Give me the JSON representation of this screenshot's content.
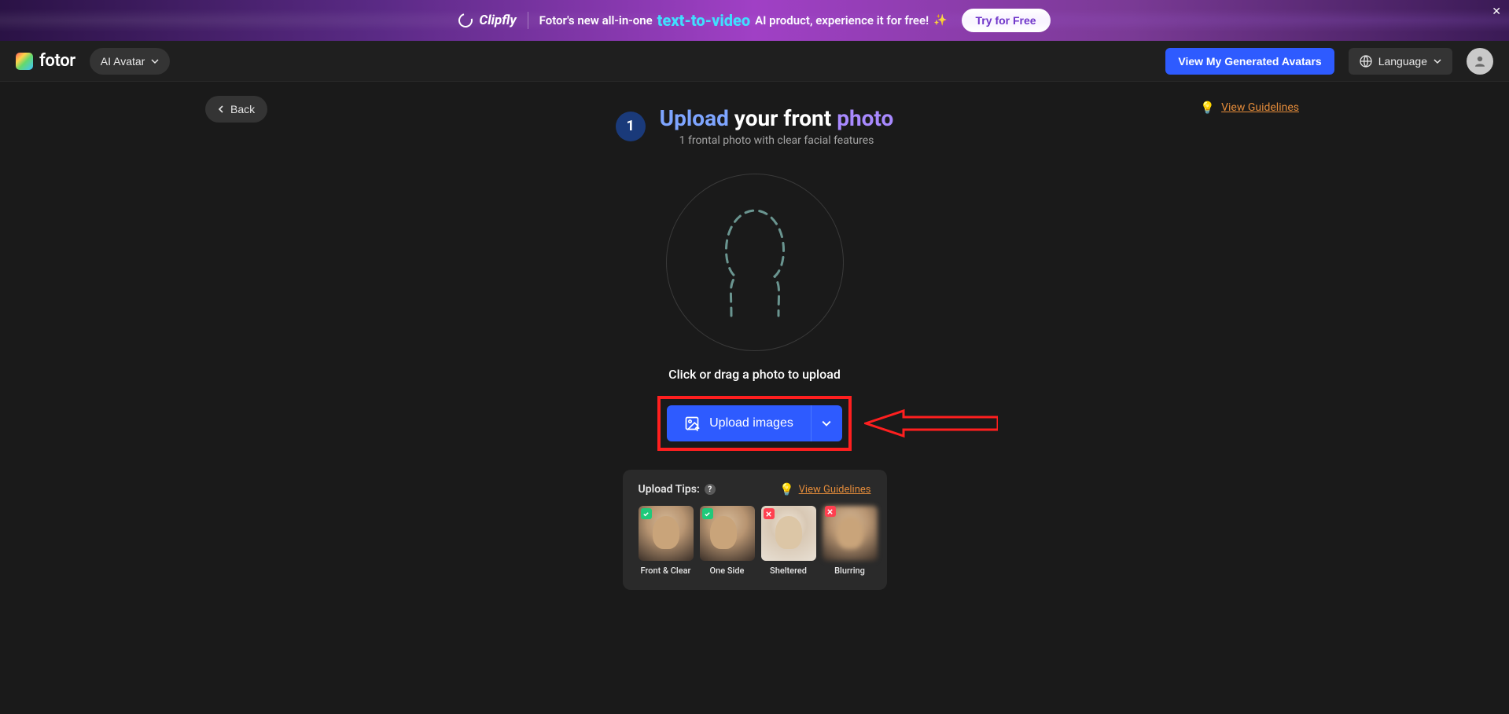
{
  "banner": {
    "logo_text": "Clipfly",
    "text_pre": "Fotor's new all-in-one",
    "text_highlight": "text-to-video",
    "text_post": "AI product, experience it for free!",
    "cta": "Try for Free"
  },
  "header": {
    "brand": "fotor",
    "product_dropdown": "AI Avatar",
    "view_generated": "View My Generated Avatars",
    "language": "Language"
  },
  "page": {
    "back": "Back",
    "step_number": "1",
    "title_word1": "Upload",
    "title_word2": "your front",
    "title_word3": "photo",
    "subtitle": "1 frontal photo with clear facial features",
    "guidelines_link": "View Guidelines",
    "drop_text": "Click or drag a photo to upload",
    "upload_button": "Upload images"
  },
  "tips": {
    "heading": "Upload Tips:",
    "guidelines_link": "View Guidelines",
    "items": [
      {
        "label": "Front & Clear",
        "status": "good"
      },
      {
        "label": "One Side",
        "status": "good"
      },
      {
        "label": "Sheltered",
        "status": "bad"
      },
      {
        "label": "Blurring",
        "status": "bad"
      }
    ]
  }
}
